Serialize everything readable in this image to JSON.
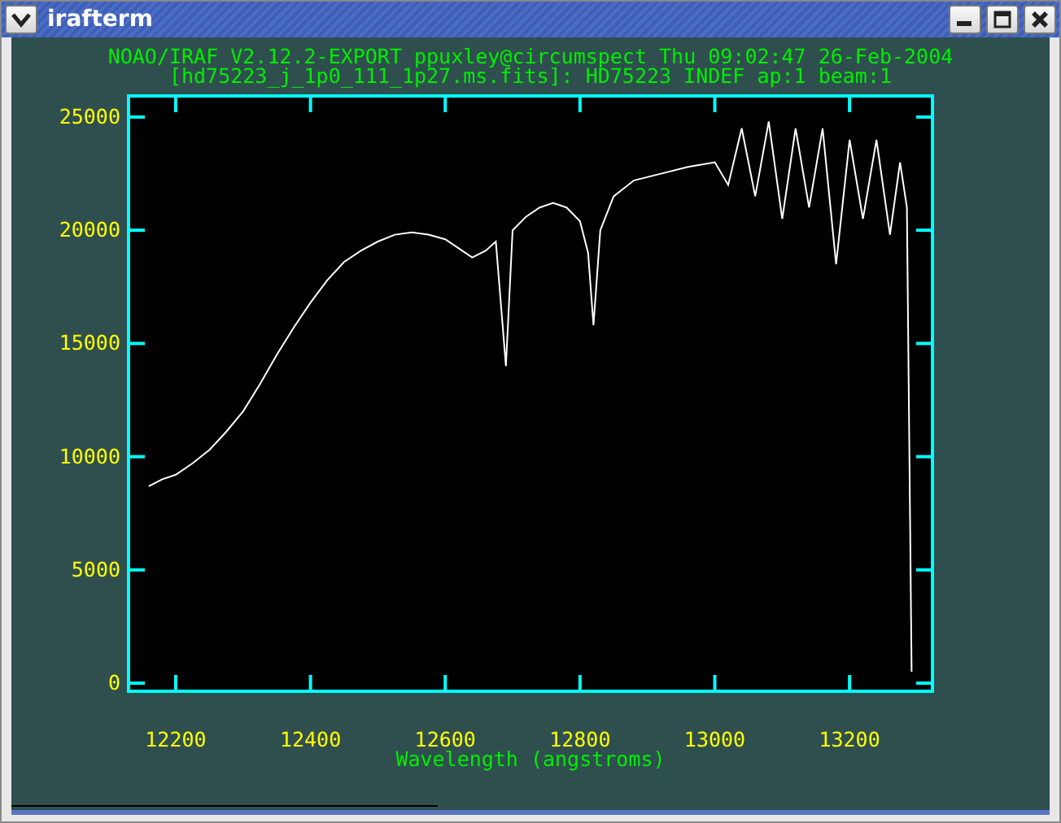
{
  "window": {
    "title": "irafterm"
  },
  "plot": {
    "header": [
      "NOAO/IRAF V2.12.2-EXPORT ppuxley@circumspect Thu 09:02:47 26-Feb-2004",
      "[hd75223_j_1p0_111_1p27.ms.fits]: HD75223 INDEF ap:1 beam:1"
    ],
    "chart_data": {
      "type": "line",
      "xlabel": "Wavelength (angstroms)",
      "x": [
        12160,
        12180,
        12200,
        12225,
        12250,
        12275,
        12300,
        12325,
        12350,
        12375,
        12400,
        12425,
        12450,
        12475,
        12500,
        12525,
        12550,
        12575,
        12600,
        12620,
        12640,
        12660,
        12675,
        12690,
        12700,
        12720,
        12740,
        12760,
        12780,
        12800,
        12812,
        12820,
        12830,
        12850,
        12880,
        12920,
        12960,
        13000,
        13020,
        13040,
        13060,
        13080,
        13100,
        13120,
        13140,
        13160,
        13180,
        13200,
        13220,
        13240,
        13260,
        13275,
        13285,
        13292
      ],
      "series": [
        {
          "color": "#ffffff",
          "values": [
            8700,
            9000,
            9200,
            9700,
            10300,
            11100,
            12000,
            13200,
            14500,
            15700,
            16800,
            17800,
            18600,
            19100,
            19500,
            19800,
            19900,
            19800,
            19600,
            19200,
            18800,
            19100,
            19500,
            14000,
            20000,
            20600,
            21000,
            21200,
            21000,
            20400,
            19000,
            15800,
            20000,
            21500,
            22200,
            22500,
            22800,
            23000,
            22000,
            24500,
            21500,
            24800,
            20500,
            24500,
            21000,
            24500,
            18500,
            24000,
            20500,
            24000,
            19800,
            23000,
            21000,
            500
          ]
        }
      ],
      "xlim": [
        12130,
        13323
      ],
      "ylim": [
        -360,
        25930
      ],
      "xticks": [
        12200,
        12400,
        12600,
        12800,
        13000,
        13200
      ],
      "yticks": [
        0,
        5000,
        10000,
        15000,
        20000,
        25000
      ]
    }
  }
}
